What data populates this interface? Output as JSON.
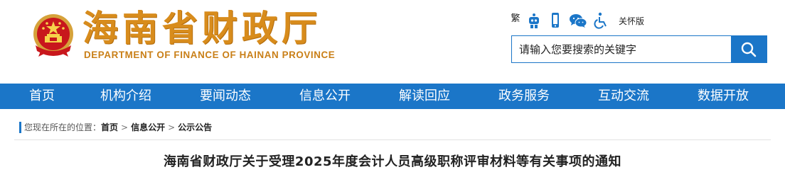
{
  "header": {
    "title": "海南省财政厅",
    "subtitle": "DEPARTMENT OF FINANCE OF HAINAN PROVINCE"
  },
  "toolbar": {
    "traditional_label": "繁",
    "care_mode_label": "关怀版"
  },
  "search": {
    "placeholder": "请输入您要搜索的关键字"
  },
  "nav": {
    "items": [
      {
        "label": "首页"
      },
      {
        "label": "机构介绍"
      },
      {
        "label": "要闻动态"
      },
      {
        "label": "信息公开"
      },
      {
        "label": "解读回应"
      },
      {
        "label": "政务服务"
      },
      {
        "label": "互动交流"
      },
      {
        "label": "数据开放"
      }
    ]
  },
  "breadcrumb": {
    "prefix": "您现在所在的位置：",
    "items": [
      "首页",
      "信息公开",
      "公示公告"
    ],
    "separator": ">"
  },
  "article": {
    "title": "海南省财政厅关于受理2025年度会计人员高级职称评审材料等有关事项的通知"
  },
  "colors": {
    "brand_blue": "#1b76c8",
    "title_gold": "#d88c1c"
  }
}
